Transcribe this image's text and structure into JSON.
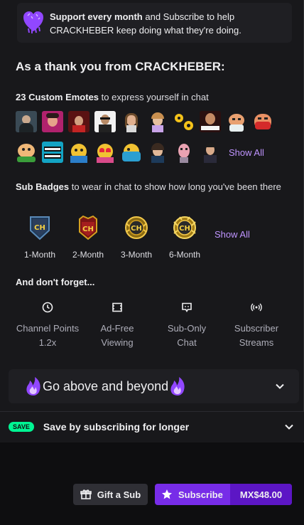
{
  "support": {
    "bold_text": "Support every month",
    "text": " and Subscribe to help CRACKHEBER keep doing what they're doing."
  },
  "thanks_title": "As a thank you from CRACKHEBER:",
  "emotes": {
    "title_bold": "23 Custom Emotes",
    "title_rest": " to express yourself in chat",
    "show_all": "Show All",
    "row1": [
      "emote-1",
      "emote-2",
      "emote-3",
      "emote-4",
      "emote-5",
      "emote-6",
      "emote-7",
      "emote-8",
      "emote-9",
      "emote-10"
    ],
    "row2": [
      "emote-11",
      "emote-12",
      "emote-13",
      "emote-14",
      "emote-15",
      "emote-16",
      "emote-17",
      "emote-18"
    ]
  },
  "badges": {
    "title_bold": "Sub Badges",
    "title_rest": " to wear in chat to show how long you've been there",
    "items": [
      {
        "label": "1-Month",
        "text": "CH"
      },
      {
        "label": "2-Month",
        "text": "CH"
      },
      {
        "label": "3-Month",
        "text": "CH"
      },
      {
        "label": "6-Month",
        "text": "CH"
      }
    ],
    "show_all": "Show All"
  },
  "dont_forget": "And don't forget...",
  "perks": [
    {
      "line1": "Channel Points",
      "line2": "1.2x",
      "icon": "channel-points-icon"
    },
    {
      "line1": "Ad-Free",
      "line2": "Viewing",
      "icon": "ad-free-icon"
    },
    {
      "line1": "Sub-Only",
      "line2": "Chat",
      "icon": "chat-icon"
    },
    {
      "line1": "Subscriber",
      "line2": "Streams",
      "icon": "broadcast-icon"
    }
  ],
  "above": {
    "label": "Go above and beyond"
  },
  "save": {
    "badge": "SAVE",
    "label": "Save by subscribing for longer"
  },
  "actions": {
    "gift_label": "Gift a Sub",
    "subscribe_label": "Subscribe",
    "price": "MX$48.00"
  },
  "colors": {
    "accent": "#772ce8",
    "link": "#bf94ff",
    "save": "#00f593"
  }
}
